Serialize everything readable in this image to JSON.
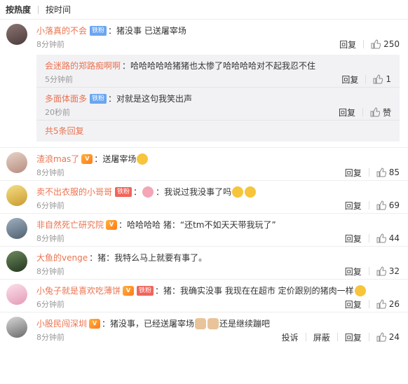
{
  "sort": {
    "hot": "按热度",
    "time": "按时间"
  },
  "actions": {
    "reply": "回复",
    "report": "投诉",
    "block": "屏蔽"
  },
  "top_comment": {
    "user": "小落真的不会",
    "badge": "铁粉",
    "text": "猪没事 已送屠宰场",
    "time": "8分钟前",
    "likes": "250",
    "avatar_color": "#6b5a58"
  },
  "replies": [
    {
      "user": "会迷路的郑路痴啊啊",
      "text": "哈哈哈哈哈猪猪也太惨了哈哈哈哈对不起我忍不住",
      "time": "5分钟前",
      "likes": "1"
    },
    {
      "user": "多面体面多",
      "badge": "铁粉",
      "text": "对就是这句我笑出声",
      "time": "20秒前",
      "likes": "赞"
    }
  ],
  "more_replies": "共5条回复",
  "comments": [
    {
      "user": "渣浪mas了",
      "text": "送屠宰场",
      "time": "8分钟前",
      "likes": "85",
      "avatar_color": "#c9a9a0"
    },
    {
      "user": "卖不出衣服的小哥哥",
      "badge": "铁粉",
      "text": "我说过我没事了吗",
      "time": "6分钟前",
      "likes": "69",
      "avatar_color": "#d9b44a"
    },
    {
      "user": "非自然死亡研究院",
      "text": "哈哈哈哈  猪：“还tm不如天天带我玩了”",
      "time": "8分钟前",
      "likes": "44",
      "avatar_color": "#7a8d9e"
    },
    {
      "user": "大鱼的venge",
      "text": "猪：我特么马上就要有事了。",
      "time": "8分钟前",
      "likes": "32",
      "avatar_color": "#3d5a3c"
    },
    {
      "user": "小兔子就是喜欢吃薄饼",
      "badge": "铁粉",
      "text": "猪：我确实没事 我现在在超市 定价跟别的猪肉一样",
      "time": "6分钟前",
      "likes": "26",
      "avatar_color": "#e7b3c4"
    },
    {
      "user": "小股民闯深圳",
      "text_a": "猪没事，已经送屠宰场",
      "text_b": "还是继续蹦吧",
      "time": "8分钟前",
      "likes": "24",
      "avatar_color": "#8a8a8a"
    }
  ],
  "icons": {
    "like": "thumbs-up-icon",
    "emoji": "emoji-icon",
    "vip": "vip-icon"
  },
  "colors": {
    "username": "#eb7350",
    "badge_blue": "#6aa6f0",
    "badge_red": "#f0655b",
    "reply_bg": "#f2f2f5",
    "meta": "#999999"
  }
}
